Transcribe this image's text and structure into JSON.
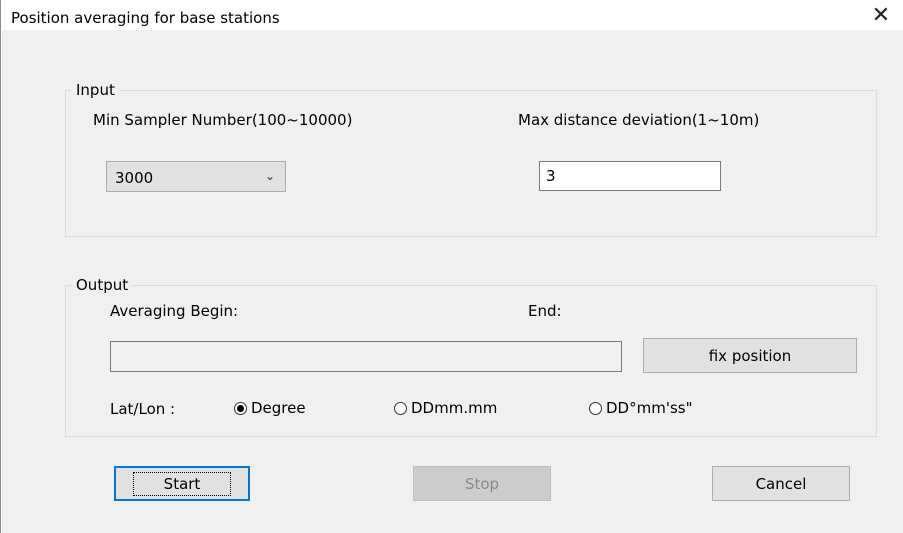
{
  "window": {
    "title": "Position averaging for base stations",
    "close_glyph": "✕"
  },
  "input_group": {
    "label": "Input",
    "min_sampler_label": "Min Sampler Number(100~10000)",
    "min_sampler_value": "3000",
    "max_distance_label": "Max distance deviation(1~10m)",
    "max_distance_value": "3"
  },
  "output_group": {
    "label": "Output",
    "averaging_begin_label": "Averaging Begin:",
    "end_label": "End:",
    "averaging_value": "",
    "fix_position_button": "fix position",
    "latlon_label": "Lat/Lon :",
    "radio_options": [
      {
        "label": "Degree",
        "selected": true
      },
      {
        "label": "DDmm.mm",
        "selected": false
      },
      {
        "label": "DD°mm'ss\"",
        "selected": false
      }
    ]
  },
  "buttons": {
    "start": "Start",
    "stop": "Stop",
    "cancel": "Cancel"
  },
  "icons": {
    "close": "close-icon",
    "dropdown": "chevron-down-icon"
  },
  "colors": {
    "dialog_background": "#f0f0f0",
    "button_face": "#e1e1e1",
    "default_button_border": "#0078d7",
    "disabled_text": "#8a8a8a"
  }
}
